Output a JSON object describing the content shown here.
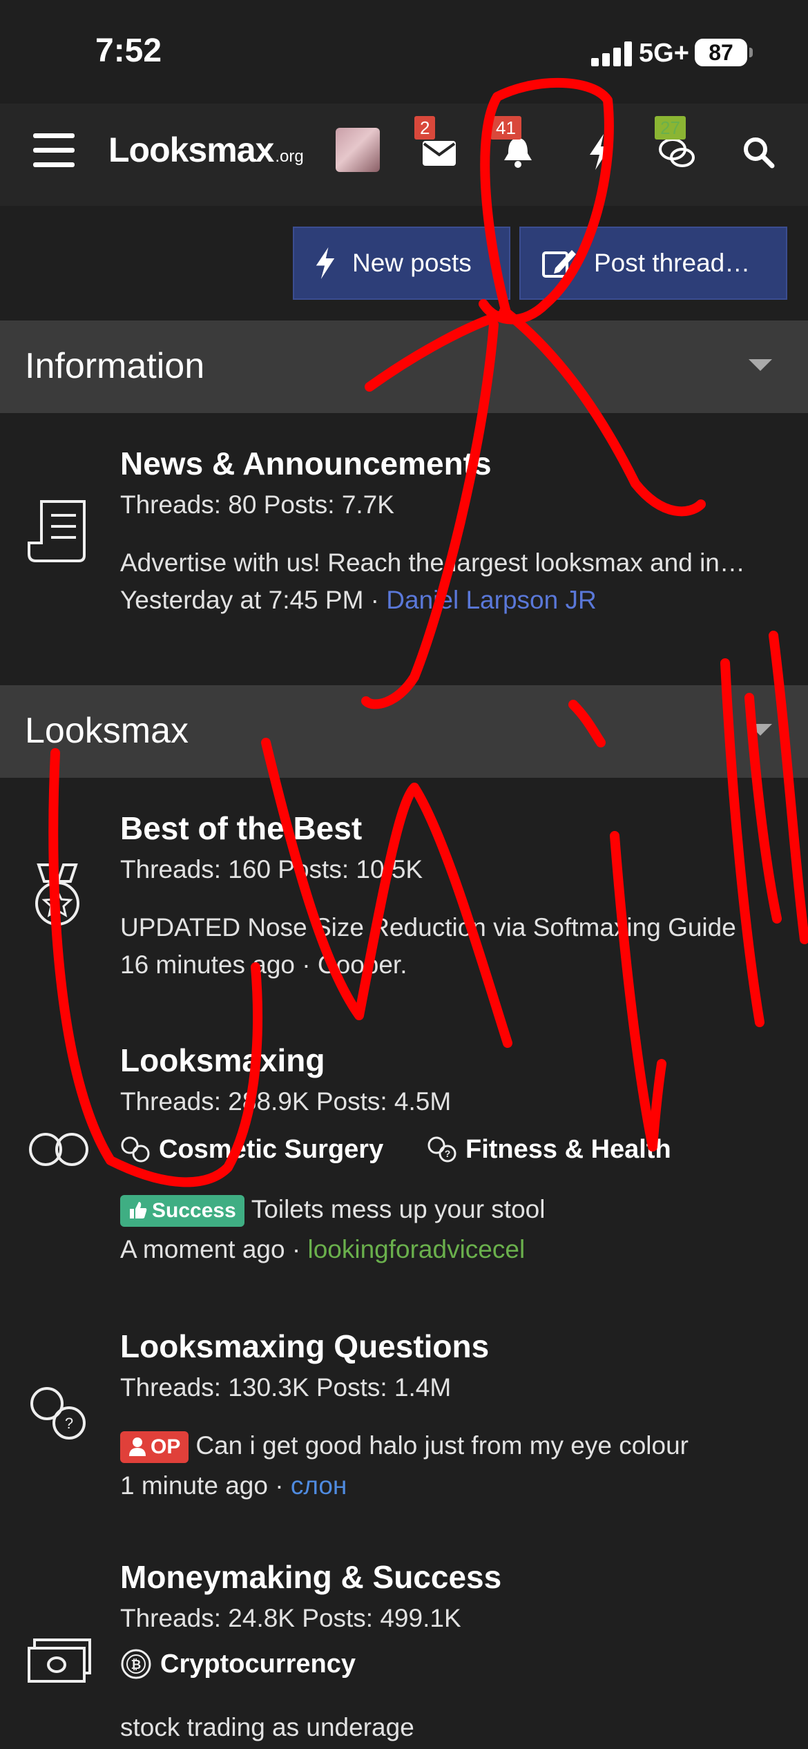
{
  "status_bar": {
    "time": "7:52",
    "network": "5G+",
    "battery": "87"
  },
  "nav": {
    "logo_main": "Looksmax",
    "logo_suffix": ".org",
    "badges": {
      "inbox": "2",
      "alerts": "41",
      "chat": "27"
    }
  },
  "actions": {
    "new_posts": "New posts",
    "post_thread": "Post thread…"
  },
  "sections": [
    {
      "title": "Information"
    },
    {
      "title": "Looksmax"
    }
  ],
  "forums": [
    {
      "title": "News & Announcements",
      "stats": "Threads: 80 Posts: 7.7K",
      "latest_title": "Advertise with us! Reach the largest looksmax and in…",
      "latest_time": "Yesterday at 7:45 PM",
      "latest_user": "Daniel Larpson JR"
    },
    {
      "title": "Best of the Best",
      "stats": "Threads: 160 Posts: 10.5K",
      "latest_title": "UPDATED Nose Size Reduction via Softmaxing Guide",
      "latest_time": "16 minutes ago",
      "latest_user": "Cooper."
    },
    {
      "title": "Looksmaxing",
      "stats": "Threads: 288.9K Posts: 4.5M",
      "subforums": [
        "Cosmetic Surgery",
        "Fitness & Health"
      ],
      "prefix": "Success",
      "latest_title": "Toilets mess up your stool",
      "latest_time": "A moment ago",
      "latest_user": "lookingforadvicecel"
    },
    {
      "title": "Looksmaxing Questions",
      "stats": "Threads: 130.3K Posts: 1.4M",
      "prefix": "OP",
      "latest_title": "Can i get good halo just from my eye colour",
      "latest_time": "1 minute ago",
      "latest_user": "слон"
    },
    {
      "title": "Moneymaking & Success",
      "stats": "Threads: 24.8K Posts: 499.1K",
      "subforums": [
        "Cryptocurrency"
      ],
      "latest_title": "stock trading as underage"
    }
  ],
  "colors": {
    "accent_blue": "#2d3e78",
    "link_blue": "#5a78d9",
    "success_green": "#3fae83",
    "op_red": "#e0403a",
    "annotation_red": "#ff0000"
  }
}
